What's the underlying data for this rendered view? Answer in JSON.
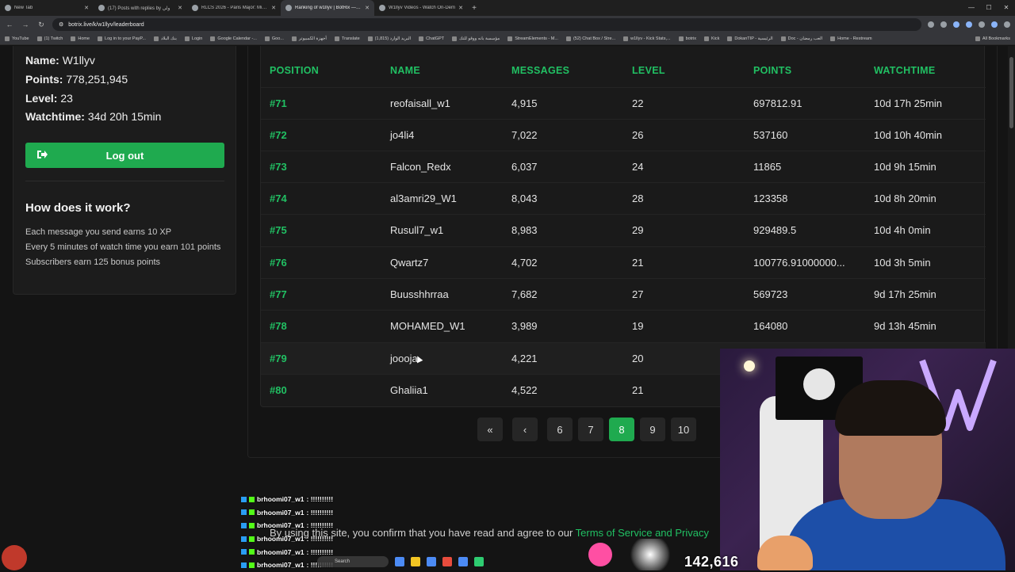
{
  "browser": {
    "tabs": [
      {
        "label": "New Tab",
        "active": false
      },
      {
        "label": "(17) Posts with replies by ولي",
        "active": false
      },
      {
        "label": "RLCS 2026 - Paris Major: Middl",
        "active": false
      },
      {
        "label": "Ranking of w1llyv | BotRix — Ci",
        "active": true
      },
      {
        "label": "W1llyv Videos - Watch On-Dem",
        "active": false
      }
    ],
    "url": "botrix.live/k/w1llyv/leaderboard",
    "bookmarks": [
      "YouTube",
      "(1) Twitch",
      "Home",
      "Log in to your PayP...",
      "بنك البلاد",
      "Login",
      "Google Calendar -...",
      "Goo...",
      "أجهزة الكمبيوتر",
      "Translate",
      "(1,815) البريد الوارد",
      "ChatGPT",
      "مؤسسة بانه ووقو للتك",
      "StreamElements - M...",
      "(52) Chat Box / Stre...",
      "w1llyv - Kick Stats,...",
      "botrix",
      "Kick",
      "DokanTIP - الرئيسية",
      "Doc - العب رمضان",
      "Home - Restream"
    ],
    "all_bookmarks": "All Bookmarks"
  },
  "profile": {
    "name_label": "Name:",
    "name_value": "W1llyv",
    "points_label": "Points:",
    "points_value": "778,251,945",
    "level_label": "Level:",
    "level_value": "23",
    "watchtime_label": "Watchtime:",
    "watchtime_value": "34d 20h 15min",
    "logout_label": "Log out"
  },
  "how": {
    "title": "How does it work?",
    "lines": [
      "Each message you send earns 10 XP",
      "Every 5 minutes of watch time you earn 101 points",
      "Subscribers earn 125 bonus points"
    ]
  },
  "table": {
    "headers": [
      "POSITION",
      "NAME",
      "MESSAGES",
      "LEVEL",
      "POINTS",
      "WATCHTIME"
    ],
    "rows": [
      [
        "#71",
        "reofaisall_w1",
        "4,915",
        "22",
        "697812.91",
        "10d 17h 25min"
      ],
      [
        "#72",
        "jo4li4",
        "7,022",
        "26",
        "537160",
        "10d 10h 40min"
      ],
      [
        "#73",
        "Falcon_Redx",
        "6,037",
        "24",
        "11865",
        "10d 9h 15min"
      ],
      [
        "#74",
        "al3amri29_W1",
        "8,043",
        "28",
        "123358",
        "10d 8h 20min"
      ],
      [
        "#75",
        "Rusull7_w1",
        "8,983",
        "29",
        "929489.5",
        "10d 4h 0min"
      ],
      [
        "#76",
        "Qwartz7",
        "4,702",
        "21",
        "100776.91000000...",
        "10d 3h 5min"
      ],
      [
        "#77",
        "Buusshhrraa",
        "7,682",
        "27",
        "569723",
        "9d 17h 25min"
      ],
      [
        "#78",
        "MOHAMED_W1",
        "3,989",
        "19",
        "164080",
        "9d 13h 45min"
      ],
      [
        "#79",
        "joooja",
        "4,221",
        "20",
        "",
        ""
      ],
      [
        "#80",
        "Ghaliia1",
        "4,522",
        "21",
        "",
        ""
      ]
    ]
  },
  "pagination": {
    "first": "«",
    "prev": "‹",
    "pages": [
      "6",
      "7",
      "8",
      "9",
      "10"
    ],
    "active": "8"
  },
  "overlay": {
    "chat_lines": [
      {
        "user": "brhoomi07_w1",
        "text": ": !!!!!!!!!!"
      },
      {
        "user": "brhoomi07_w1",
        "text": ": !!!!!!!!!!"
      },
      {
        "user": "brhoomi07_w1",
        "text": ": !!!!!!!!!!"
      },
      {
        "user": "brhoomi07_w1",
        "text": ": !!!!!!!!!!"
      },
      {
        "user": "brhoomi07_w1",
        "text": ": !!!!!!!!!!"
      },
      {
        "user": "brhoomi07_w1",
        "text": ": !!!!!!!!!!"
      }
    ],
    "cookie_text": "By using this site, you confirm that you have read and agree to our ",
    "cookie_link": "Terms of Service and Privacy",
    "viewer_count": "142,616",
    "taskbar_search": "Search"
  },
  "colors": {
    "accent": "#21c063",
    "button": "#1faa4f",
    "page_bg": "#141414",
    "card_bg": "#1c1c1c"
  }
}
